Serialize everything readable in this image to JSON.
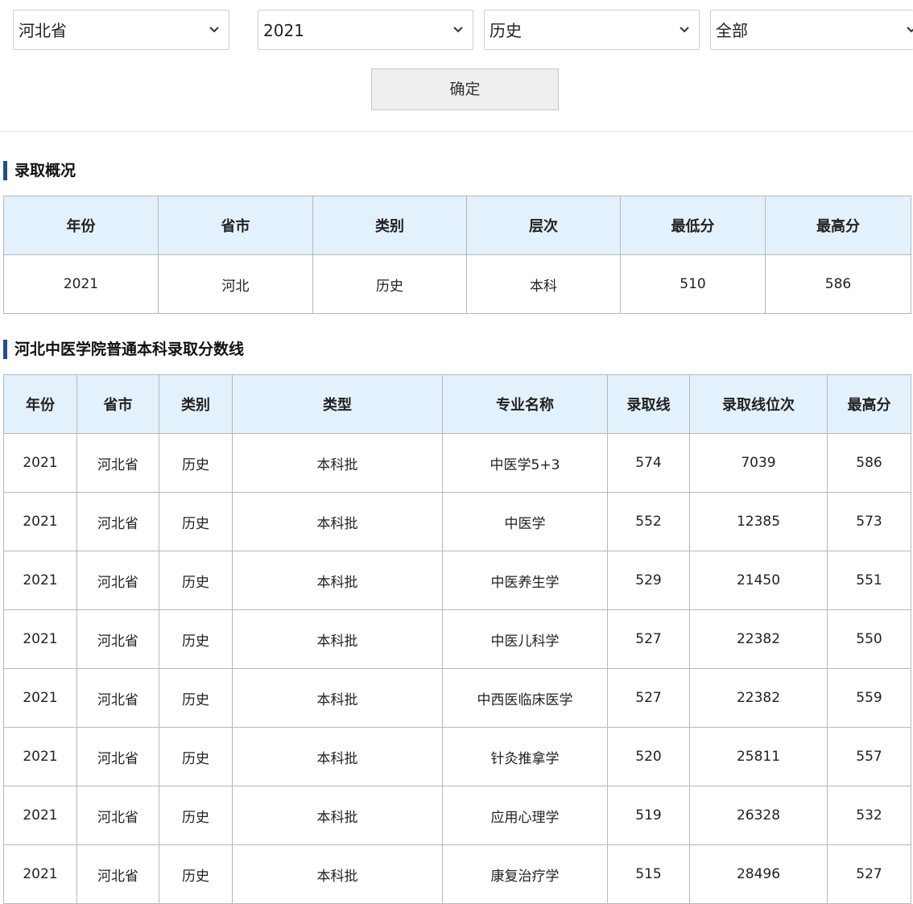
{
  "filters": {
    "province": "河北省",
    "year": "2021",
    "subject": "历史",
    "batch": "全部",
    "confirm_label": "确定"
  },
  "summary": {
    "title": "录取概况",
    "headers": [
      "年份",
      "省市",
      "类别",
      "层次",
      "最低分",
      "最高分"
    ],
    "rows": [
      [
        "2021",
        "河北",
        "历史",
        "本科",
        "510",
        "586"
      ]
    ]
  },
  "scores": {
    "title": "河北中医学院普通本科录取分数线",
    "headers": [
      "年份",
      "省市",
      "类别",
      "类型",
      "专业名称",
      "录取线",
      "录取线位次",
      "最高分"
    ],
    "rows": [
      [
        "2021",
        "河北省",
        "历史",
        "本科批",
        "中医学5+3",
        "574",
        "7039",
        "586"
      ],
      [
        "2021",
        "河北省",
        "历史",
        "本科批",
        "中医学",
        "552",
        "12385",
        "573"
      ],
      [
        "2021",
        "河北省",
        "历史",
        "本科批",
        "中医养生学",
        "529",
        "21450",
        "551"
      ],
      [
        "2021",
        "河北省",
        "历史",
        "本科批",
        "中医儿科学",
        "527",
        "22382",
        "550"
      ],
      [
        "2021",
        "河北省",
        "历史",
        "本科批",
        "中西医临床医学",
        "527",
        "22382",
        "559"
      ],
      [
        "2021",
        "河北省",
        "历史",
        "本科批",
        "针灸推拿学",
        "520",
        "25811",
        "557"
      ],
      [
        "2021",
        "河北省",
        "历史",
        "本科批",
        "应用心理学",
        "519",
        "26328",
        "532"
      ],
      [
        "2021",
        "河北省",
        "历史",
        "本科批",
        "康复治疗学",
        "515",
        "28496",
        "527"
      ]
    ]
  },
  "icons": {
    "select_chevron": "chevron-down-icon"
  },
  "colors": {
    "header_bg": "#e3f1fd",
    "title_bar": "#1f4e8f"
  }
}
